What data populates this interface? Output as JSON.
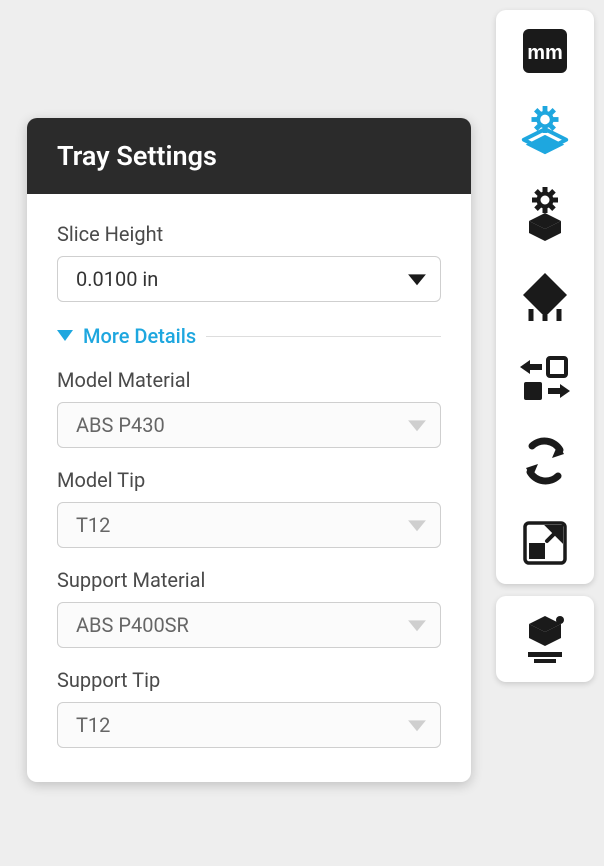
{
  "panel": {
    "title": "Tray Settings",
    "slice_height_label": "Slice Height",
    "slice_height_value": "0.0100 in",
    "more_details_label": "More Details",
    "model_material_label": "Model Material",
    "model_material_value": "ABS P430",
    "model_tip_label": "Model Tip",
    "model_tip_value": "T12",
    "support_material_label": "Support Material",
    "support_material_value": "ABS P400SR",
    "support_tip_label": "Support Tip",
    "support_tip_value": "T12"
  },
  "rail": {
    "units_label": "mm",
    "icons": {
      "units": "units-icon",
      "tray_settings": "tray-settings-icon",
      "part_settings": "part-settings-icon",
      "supports": "supports-icon",
      "swap": "swap-icon",
      "rotate": "rotate-icon",
      "scale": "scale-icon",
      "print": "print-icon"
    }
  },
  "colors": {
    "accent": "#1ea7df",
    "header": "#2b2b2b",
    "ink": "#1a1a1a"
  }
}
